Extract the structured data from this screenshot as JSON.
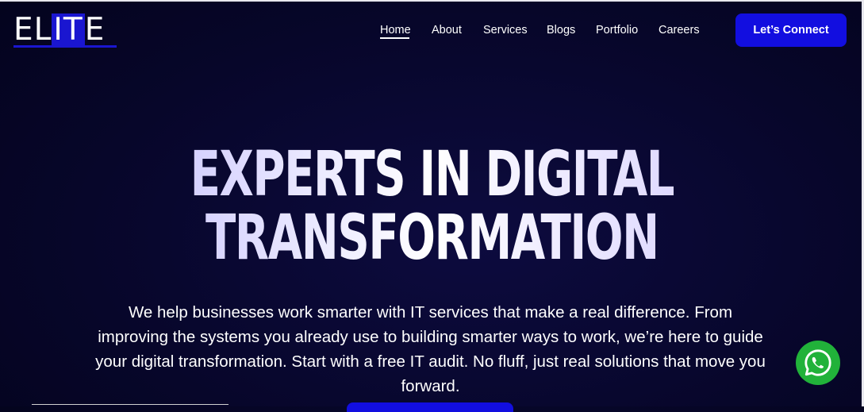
{
  "logo": {
    "part1": "EL",
    "part2": "IT",
    "part3": "E"
  },
  "nav": {
    "items": [
      {
        "label": "Home",
        "active": true
      },
      {
        "label": "About"
      },
      {
        "label": "Services"
      },
      {
        "label": "Blogs"
      },
      {
        "label": "Portfolio"
      },
      {
        "label": "Careers"
      }
    ],
    "cta_label": "Let’s Connect"
  },
  "hero": {
    "title_line1": "EXPERTS IN DIGITAL",
    "title_line2": "TRANSFORMATION",
    "description": "We help businesses work smarter with IT services that make a real difference. From improving the systems you already use to building smarter ways to work, we’re here to guide your digital transformation. Start with a free IT audit. No fluff, just real solutions that move you forward."
  },
  "floating": {
    "icon": "whatsapp-icon"
  },
  "colors": {
    "accent": "#120ee0",
    "background": "#07062a",
    "whatsapp": "#21b23a"
  }
}
